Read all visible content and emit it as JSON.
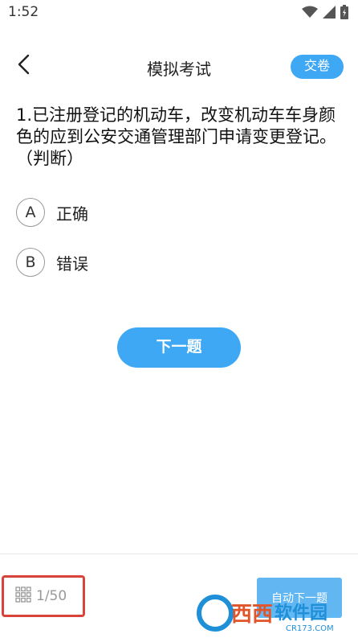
{
  "status_bar": {
    "time": "1:52",
    "icons": [
      "wifi-icon",
      "signal-icon",
      "battery-icon"
    ]
  },
  "header": {
    "title": "模拟考试",
    "submit_label": "交卷",
    "back_icon": "chevron-left-icon"
  },
  "question": {
    "text": "1.已注册登记的机动车，改变机动车车身颜色的应到公安交通管理部门申请变更登记。（判断）"
  },
  "options": [
    {
      "letter": "A",
      "text": "正确"
    },
    {
      "letter": "B",
      "text": "错误"
    }
  ],
  "next_button": {
    "label": "下一题"
  },
  "bottom_bar": {
    "progress": "1/50",
    "auto_next_label": "自动下一题"
  },
  "watermark": {
    "text": "西西软件园",
    "sub": "CR173.COM"
  },
  "colors": {
    "accent": "#3fa8f4",
    "highlight_border": "#d9443a"
  }
}
